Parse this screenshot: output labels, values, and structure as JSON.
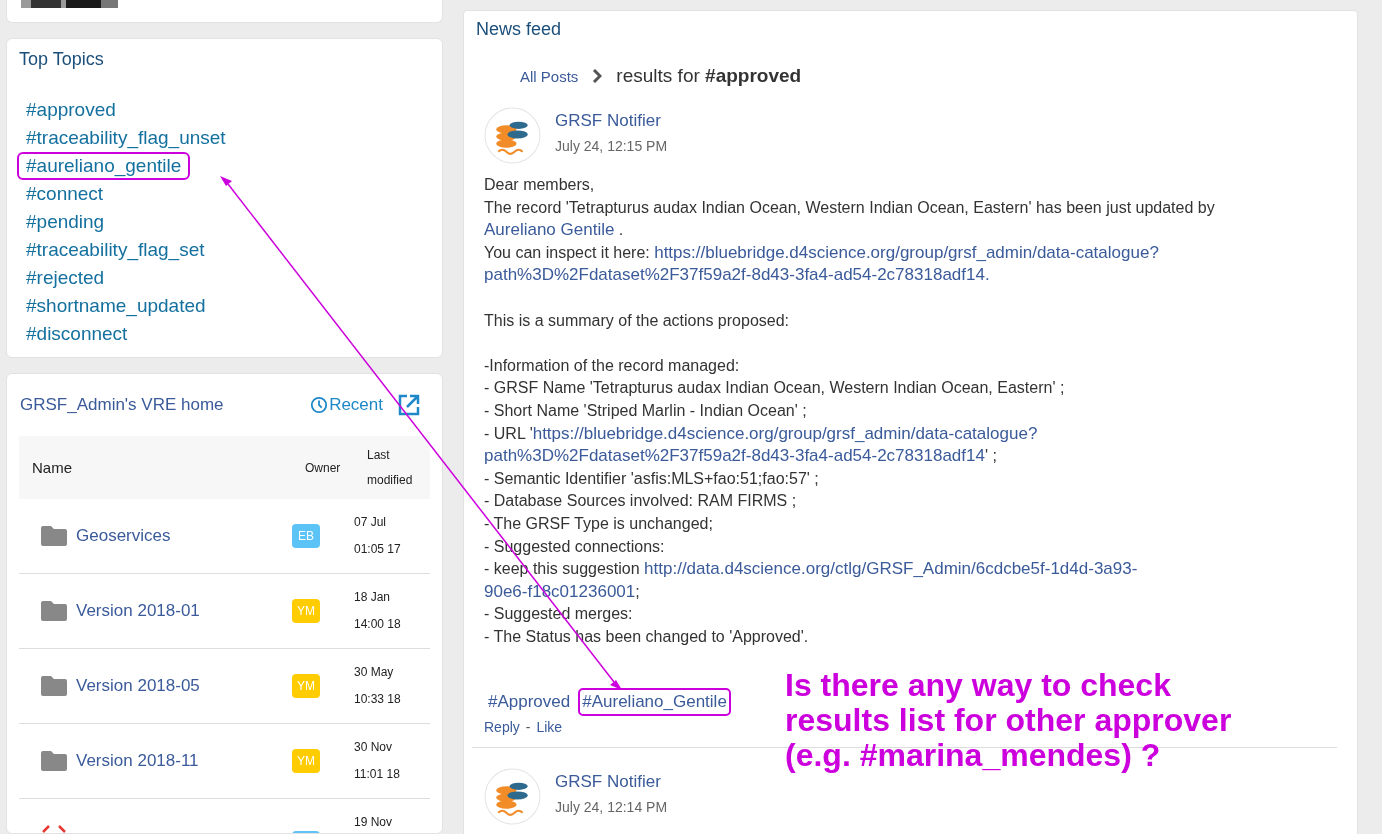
{
  "top_topics": {
    "title": "Top Topics",
    "items": [
      {
        "label": "#approved",
        "highlighted": false
      },
      {
        "label": "#traceability_flag_unset",
        "highlighted": false
      },
      {
        "label": "#aureliano_gentile",
        "highlighted": true
      },
      {
        "label": "#connect",
        "highlighted": false
      },
      {
        "label": "#pending",
        "highlighted": false
      },
      {
        "label": "#traceability_flag_set",
        "highlighted": false
      },
      {
        "label": "#rejected",
        "highlighted": false
      },
      {
        "label": "#shortname_updated",
        "highlighted": false
      },
      {
        "label": "#disconnect",
        "highlighted": false
      }
    ]
  },
  "vre": {
    "title": "GRSF_Admin's VRE home",
    "recent": "Recent",
    "columns": [
      "Name",
      "Owner",
      "Last modified"
    ],
    "rows": [
      {
        "kind": "folder",
        "name": "Geoservices",
        "owner": "EB",
        "color": "#5bc3f5",
        "date": "07 Jul",
        "time": "01:05 17"
      },
      {
        "kind": "folder",
        "name": "Version 2018-01",
        "owner": "YM",
        "color": "#ffcc00",
        "date": "18 Jan",
        "time": "14:00 18"
      },
      {
        "kind": "folder",
        "name": "Version 2018-05",
        "owner": "YM",
        "color": "#ffcc00",
        "date": "30 May",
        "time": "10:33 18"
      },
      {
        "kind": "folder",
        "name": "Version 2018-11",
        "owner": "YM",
        "color": "#ffcc00",
        "date": "30 Nov",
        "time": "11:01 18"
      },
      {
        "kind": "code",
        "color": "#5bc3f5",
        "date": "19 Nov"
      }
    ]
  },
  "news": {
    "title": "News feed",
    "breadcrumb": {
      "link": "All Posts",
      "text": "results for **#approved**"
    },
    "posts": [
      {
        "author": "GRSF Notifier",
        "time": "July 24, 12:15 PM",
        "lines": [
          [
            {
              "text": "Dear members,"
            }
          ],
          [
            {
              "text": "The record 'Tetrapturus audax Indian Ocean, Western Indian Ocean, Eastern' has been just updated by"
            }
          ],
          [
            {
              "link": "Aureliano Gentile"
            },
            {
              "text": " ."
            }
          ],
          [
            {
              "text": "You can inspect it here: "
            },
            {
              "link": "https://bluebridge.d4science.org/group/grsf_admin/data-catalogue?"
            }
          ],
          [
            {
              "link": "path%3D%2Fdataset%2F37f59a2f-8d43-3fa4-ad54-2c78318adf14."
            }
          ],
          [
            {
              "gap": true
            },
            {
              "text": "This is a summary of the actions proposed:"
            }
          ],
          [
            {
              "gap": true
            },
            {
              "text": "-Information of the record managed:"
            }
          ],
          [
            {
              "text": "- GRSF Name 'Tetrapturus audax Indian Ocean, Western Indian Ocean, Eastern' ;"
            }
          ],
          [
            {
              "text": "- Short Name 'Striped Marlin - Indian Ocean' ;"
            }
          ],
          [
            {
              "text": "- URL '"
            },
            {
              "link": "https://bluebridge.d4science.org/group/grsf_admin/data-catalogue?"
            }
          ],
          [
            {
              "link": "path%3D%2Fdataset%2F37f59a2f-8d43-3fa4-ad54-2c78318adf14"
            },
            {
              "text": "' ;"
            }
          ],
          [
            {
              "text": "- Semantic Identifier 'asfis:MLS+fao:51;fao:57' ;"
            }
          ],
          [
            {
              "text": "- Database Sources involved: RAM FIRMS ;"
            }
          ],
          [
            {
              "text": "- The GRSF Type is unchanged;"
            }
          ],
          [
            {
              "text": "- Suggested connections:"
            }
          ],
          [
            {
              "text": "- keep this suggestion "
            },
            {
              "link": "http://data.d4science.org/ctlg/GRSF_Admin/6cdcbe5f-1d4d-3a93-"
            }
          ],
          [
            {
              "link": "90e6-f18c01236001"
            },
            {
              "text": ";"
            }
          ],
          [
            {
              "text": "- Suggested merges:"
            }
          ],
          [
            {
              "text": "- The Status has been changed to 'Approved'."
            }
          ]
        ],
        "hashtags": [
          {
            "label": "#Approved",
            "highlighted": false
          },
          {
            "label": "#Aureliano_Gentile",
            "highlighted": true
          }
        ],
        "actions": [
          "Reply",
          "-",
          "Like"
        ]
      },
      {
        "author": "GRSF Notifier",
        "time": "July 24, 12:14 PM"
      }
    ]
  },
  "annotation": {
    "lines": [
      "Is there any way to check",
      "results list for other approver",
      "(e.g. #marina_mendes) ?"
    ]
  }
}
